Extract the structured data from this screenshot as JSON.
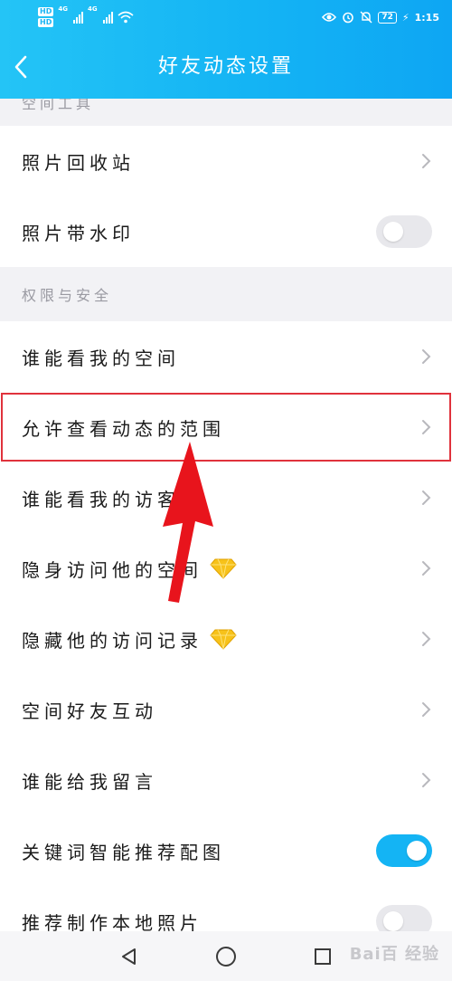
{
  "status_bar": {
    "sim1_label": "HD",
    "sim2_label": "HD",
    "network_1": "4G",
    "network_2": "4G",
    "battery": "72",
    "time": "1:15"
  },
  "header": {
    "title": "好友动态设置"
  },
  "sections": [
    {
      "title": "空间工具"
    },
    {
      "title": "权限与安全"
    }
  ],
  "rows": [
    {
      "label": "照片回收站",
      "control": "chevron"
    },
    {
      "label": "照片带水印",
      "control": "toggle",
      "toggle_state": "off"
    },
    {
      "label": "谁能看我的空间",
      "control": "chevron"
    },
    {
      "label": "允许查看动态的范围",
      "control": "chevron",
      "highlighted": true
    },
    {
      "label": "谁能看我的访客",
      "control": "chevron"
    },
    {
      "label": "隐身访问他的空间",
      "control": "chevron",
      "badge_icon": "diamond-icon"
    },
    {
      "label": "隐藏他的访问记录",
      "control": "chevron",
      "badge_icon": "diamond-icon"
    },
    {
      "label": "空间好友互动",
      "control": "chevron"
    },
    {
      "label": "谁能给我留言",
      "control": "chevron"
    },
    {
      "label": "关键词智能推荐配图",
      "control": "toggle",
      "toggle_state": "on"
    },
    {
      "label": "推荐制作本地照片",
      "control": "toggle",
      "toggle_state": "off"
    }
  ],
  "icons": {
    "back": "chevron-left-icon",
    "chevron": "chevron-right-icon",
    "nav_back": "triangle-back-icon",
    "nav_home": "circle-home-icon",
    "nav_recent": "square-recent-icon"
  },
  "colors": {
    "header_start": "#24c4f6",
    "header_end": "#0ea6f3",
    "toggle_on": "#14b4f4",
    "highlight_border": "#e0323c",
    "annotation_arrow": "#e8141c"
  },
  "watermark": "Bai百 经验"
}
